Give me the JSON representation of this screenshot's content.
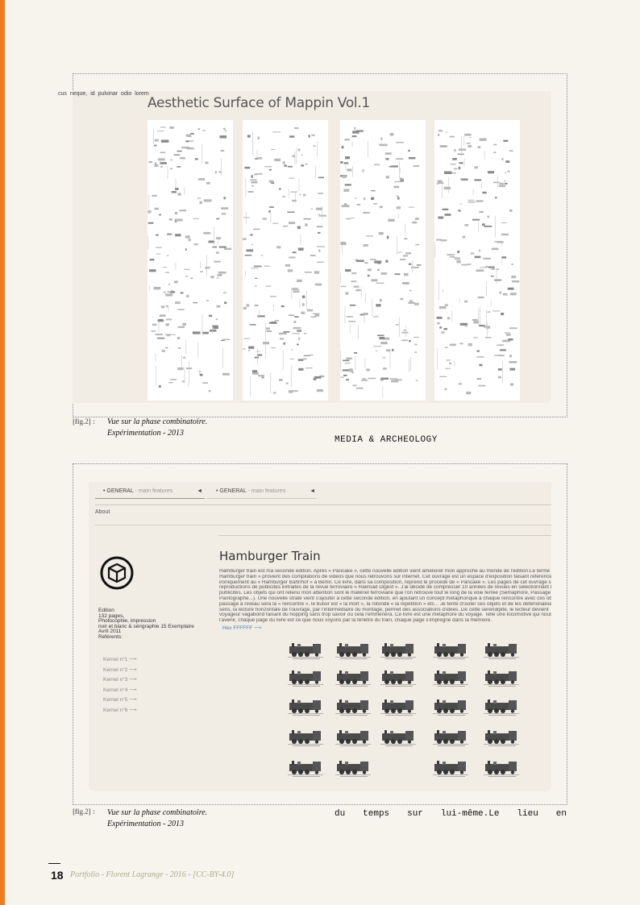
{
  "cut_text": "cus  neque,  id  pulvinar  odio  lorem",
  "figure1": {
    "title": "Aesthetic Surface of Mappin Vol.1",
    "caption_fig": "[fig.2] :",
    "caption_line1": "Vue sur la phase combinatoire.",
    "caption_line2": "Expérimentation - 2013"
  },
  "section_label": "MEDIA & ARCHEOLOGY",
  "figure2": {
    "tabs": [
      {
        "label": "GENERAL",
        "sub": " - main features",
        "arrow": "◄"
      },
      {
        "label": "GENERAL",
        "sub": " - main features",
        "arrow": "◄"
      }
    ],
    "about": "About",
    "title": "Hamburger Train",
    "body_lines": [
      "Hamburger train est ma seconde édition. Après « Pancake », cette nouvelle édition vient améliorer mon approche au monde de l'édition.Le terme",
      "Hamburger train » provient des compilations de vidéos que nous retrouvons sur internet. Cet ouvrage est un espace d'exposition faisant référence",
      "ironiquement au « Hamburger Bahnhof » à Berlin. Ce livre, dans sa composition, reprend le procédé de « Pancake ». Les pages de cet ouvrage sont des",
      "reproductions de publicités extraites de la revue ferroviaire « Railroad Digest ». J'ai décidé de compresser 10 années de revues en sélectionnant les",
      "publicités. Les objets qui ont retenu mon attention sont le matériel ferroviaire que l'on retrouve tout le long de la voie ferrée (Sémaphore, Passage",
      "Pantographe...). Une nouvelle strate vient s'ajouter à cette seconde édition, en ajoutant un concept métaphorique à chaque rencontre avec ces objets.",
      "passage à niveau sera la « rencontre », le butoir est « la mort », la rotonde « la répétition » etc... Je tente d'isoler ces objets et de les détériorialiser. Au",
      "sens, la lecture horizontale de l'ouvrage, par l'intermédiaire du montage, permet des associations d'idées. De cette sérendipité, le lecteur devient",
      "voyageur vagabond faisant du hopping sans trop savoir où cela l'emmènera. Ce livre est une métaphore du voyage. Telle une locomotive qui nous",
      "l'avenir, chaque page du livre est ce que nous voyons par la fenêtre du train, chaque page s'imprègne dans la mémoire."
    ],
    "hex_link": "Hex FFFFFF ⟶",
    "meta": [
      "Edition",
      "132 pages,",
      "Photocophie, impression",
      "noir et blanc & sérigraphie 15 Exemplaire",
      "Avril 2011",
      "Référents:"
    ],
    "kernels": [
      "Kernel n°1 ⟶",
      "Kernel n°2 ⟶",
      "Kernel n°3 ⟶",
      "Kernel n°4 ⟶",
      "Kernel n°5 ⟶",
      "Kernel n°6 ⟶"
    ],
    "caption_fig": "[fig.2] :",
    "caption_line1": "Vue sur la phase combinatoire.",
    "caption_line2": "Expérimentation - 2013"
  },
  "bottom_text": [
    "du",
    "temps",
    "sur",
    "lui-même.Le",
    "lieu",
    "en"
  ],
  "footer": {
    "page_number": "18",
    "text": "Portfolio - Florent Lagrange - 2016 - [CC-BY-4.0]"
  },
  "colors": {
    "accent": "#f07d1c",
    "footer_text": "#a8ad8a",
    "link": "#4a7fb5"
  }
}
